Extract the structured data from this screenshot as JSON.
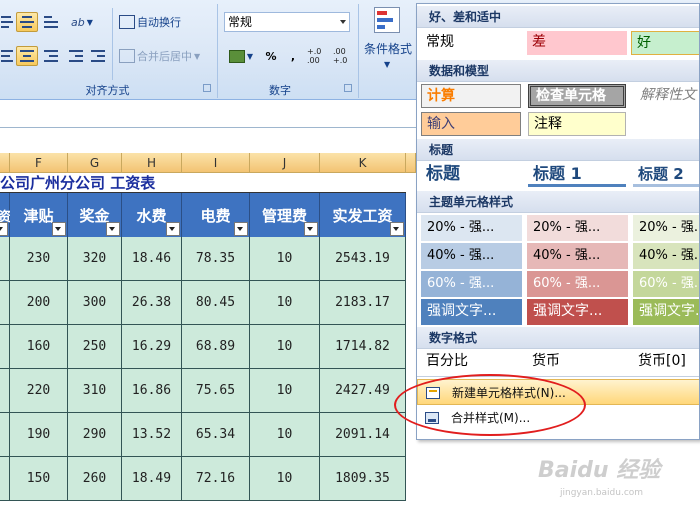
{
  "ribbon": {
    "alignment_group": {
      "wrap_text": "自动换行",
      "merge_center": "合并后居中",
      "label": "对齐方式"
    },
    "number_group": {
      "format_value": "常规",
      "percent": "%",
      "comma": ",",
      "inc_decimal": "+.0 .00",
      "dec_decimal": ".00 +.0",
      "label": "数字"
    },
    "styles_group": {
      "conditional_format": "条件格式"
    }
  },
  "columns": [
    "F",
    "G",
    "H",
    "I",
    "J",
    "K"
  ],
  "sheet": {
    "title": "公司广州分公司    工资表",
    "headers": [
      "资",
      "津贴",
      "奖金",
      "水费",
      "电费",
      "管理费",
      "实发工资"
    ],
    "rows": [
      [
        "230",
        "320",
        "18.46",
        "78.35",
        "10",
        "2543.19"
      ],
      [
        "200",
        "300",
        "26.38",
        "80.45",
        "10",
        "2183.17"
      ],
      [
        "160",
        "250",
        "16.29",
        "68.89",
        "10",
        "1714.82"
      ],
      [
        "220",
        "310",
        "16.86",
        "75.65",
        "10",
        "2427.49"
      ],
      [
        "190",
        "290",
        "13.52",
        "65.34",
        "10",
        "2091.14"
      ],
      [
        "150",
        "260",
        "18.49",
        "72.16",
        "10",
        "1809.35"
      ]
    ]
  },
  "gallery": {
    "sec_good_bad": "好、差和适中",
    "normal": "常规",
    "bad": "差",
    "good": "好",
    "sec_data_model": "数据和模型",
    "calc": "计算",
    "check_cell": "检查单元格",
    "explanatory": "解释性文",
    "input": "输入",
    "note": "注释",
    "sec_titles": "标题",
    "title": "标题",
    "heading1": "标题 1",
    "heading2": "标题 2",
    "sec_theme": "主题单元格样式",
    "theme_rows": [
      [
        "20% - 强...",
        "20% - 强...",
        "20% - 强..."
      ],
      [
        "40% - 强...",
        "40% - 强...",
        "40% - 强..."
      ],
      [
        "60% - 强...",
        "60% - 强...",
        "60% - 强..."
      ],
      [
        "强调文字...",
        "强调文字...",
        "强调文字..."
      ]
    ],
    "sec_number": "数字格式",
    "percent": "百分比",
    "currency": "货币",
    "currency0": "货币[0]",
    "new_style": "新建单元格样式(N)...",
    "merge_styles": "合并样式(M)..."
  },
  "watermark": {
    "brand": "Baidu 经验",
    "url": "jingyan.baidu.com"
  },
  "colors": {
    "header_blue": "#3e73c1",
    "data_green": "#cdeadb",
    "highlight_red": "#e11e1e"
  }
}
